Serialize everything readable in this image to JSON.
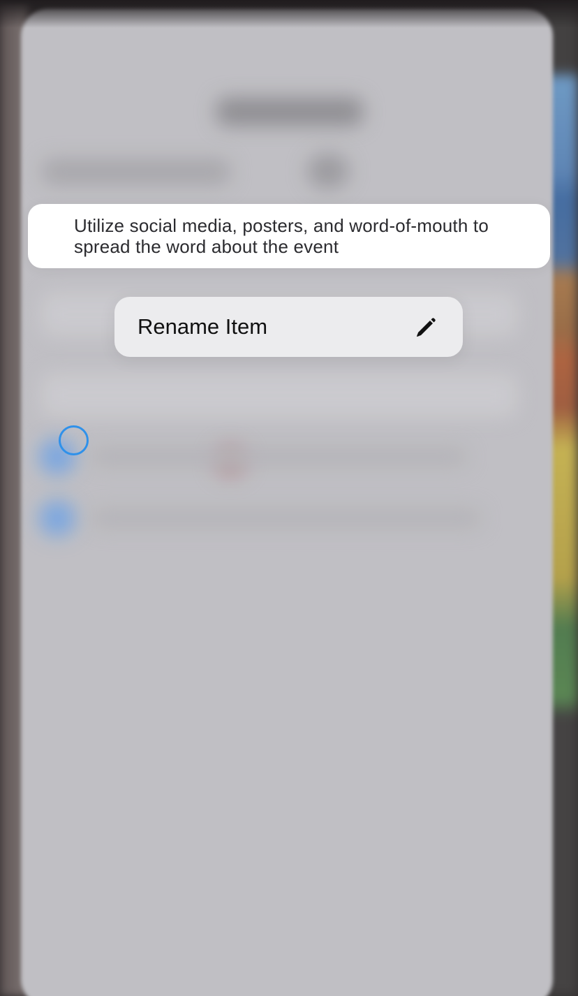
{
  "list_item": {
    "text": "Utilize social media, posters, and word-of-mouth to spread the word about the event",
    "completed": false
  },
  "context_menu": {
    "items": [
      {
        "label": "Rename Item",
        "icon": "pencil-icon"
      }
    ]
  },
  "colors": {
    "accent": "#2f91ea",
    "menu_background": "#ececee",
    "card_background": "#ffffff",
    "backdrop": "#c4c3c8"
  }
}
